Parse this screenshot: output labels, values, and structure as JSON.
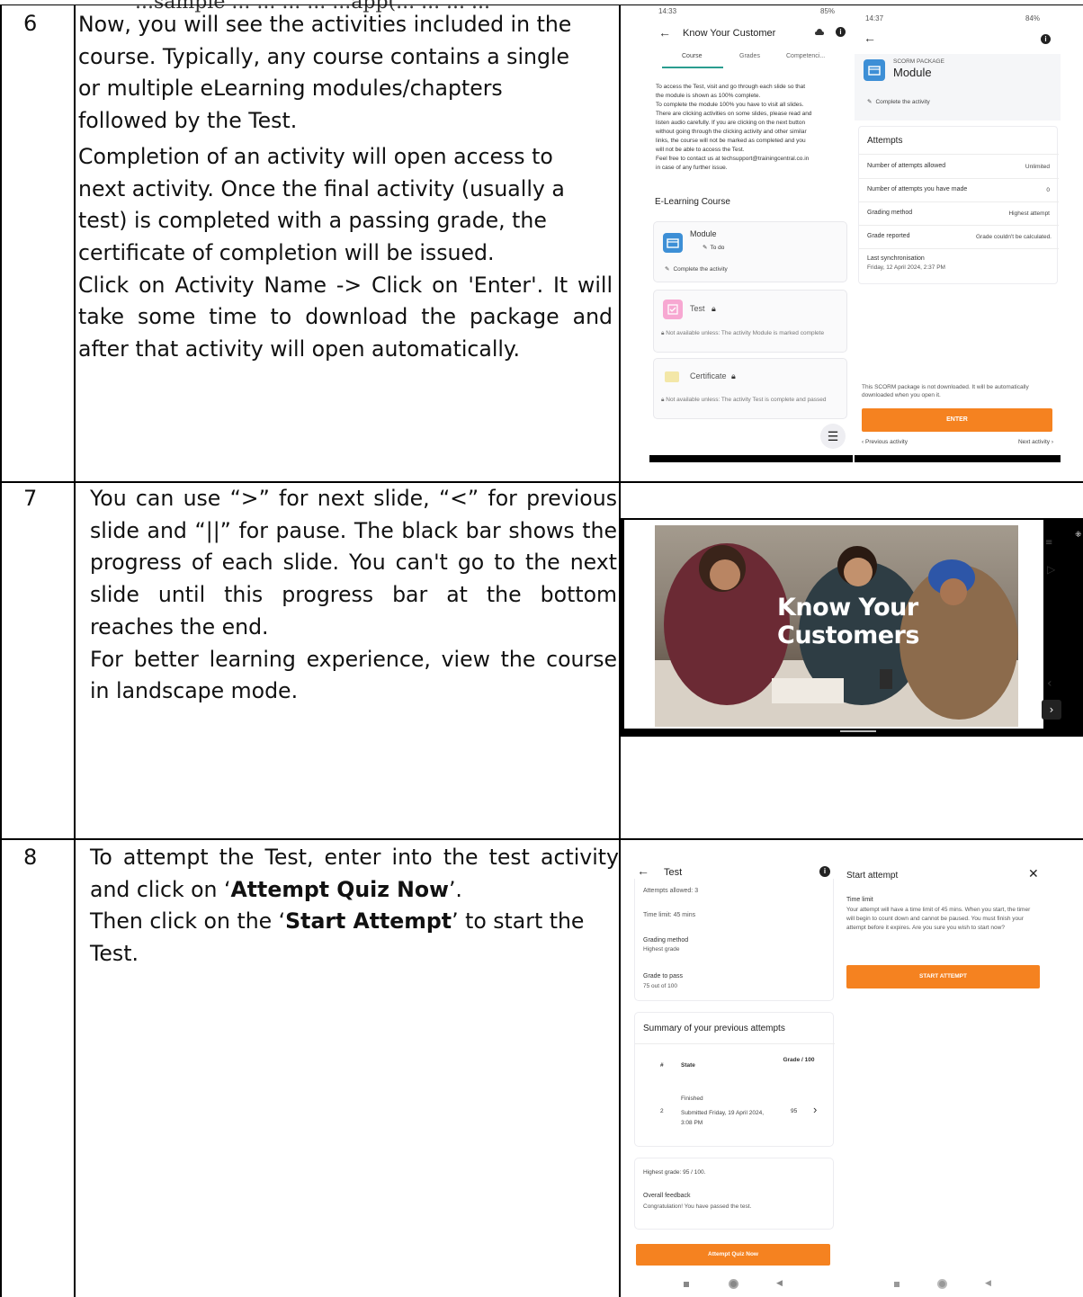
{
  "top_fragment": "...sample ... ... ... ... ...app(... ... ... ...",
  "rows": [
    {
      "number": "6",
      "paragraphs": [
        "Now, you will see the activities included in the course. Typically, any course contains a single or multiple eLearning modules/chapters followed by the Test.",
        "Completion of an activity will open access to next activity. Once the final activity (usually a test) is completed with a passing grade, the certificate of completion will be issued.",
        "Click on Activity Name -> Click on 'Enter'. It will take some time to download the package and after that activity will open automatically."
      ]
    },
    {
      "number": "7",
      "paragraphs": [
        "You can use “>” for next slide, “<” for previous slide and “||” for pause. The black bar shows the progress of each slide. You can't go to the next slide until this progress bar at the bottom reaches the end.",
        "For better learning experience, view the course in landscape mode."
      ]
    },
    {
      "number": "8",
      "paragraphs": [
        {
          "pre": "To attempt the Test, enter into the test activity and click on ‘",
          "bold": "Attempt Quiz Now",
          "post": "’."
        },
        {
          "pre": "Then click on the ‘",
          "bold": "Start Attempt",
          "post": "’ to start the Test."
        }
      ]
    }
  ],
  "phone_course": {
    "status_time": "14:33",
    "status_right": "85%",
    "title": "Know Your Customer",
    "tabs": [
      "Course",
      "Grades",
      "Competenci..."
    ],
    "info_lines": [
      "To access the Test, visit and go through each slide so that",
      "the module is shown as 100% complete.",
      "To complete the module 100% you have to visit all slides.",
      "There are clicking activities on some slides, please read and",
      "listen audio carefully. If you are clicking on the next button",
      "without going through the clicking activity and other similar",
      "links, the course will not be marked as completed and you",
      "will not be able to access the Test.",
      "Feel free to contact us at techsupport@trainingcentral.co.in",
      "in case of any further issue."
    ],
    "section": "E-Learning Course",
    "module_name": "Module",
    "module_status": "To do",
    "module_action": "Complete the activity",
    "test_name": "Test",
    "test_note": "Not available unless: The activity Module is marked complete",
    "cert_name": "Certificate",
    "cert_note": "Not available unless: The activity Test is complete and passed"
  },
  "phone_scorm": {
    "status_time": "14:37",
    "status_right": "84%",
    "kicker": "SCORM PACKAGE",
    "title": "Module",
    "action": "Complete the activity",
    "attempts_heading": "Attempts",
    "rows": [
      {
        "label": "Number of attempts allowed",
        "value": "Unlimited"
      },
      {
        "label": "Number of attempts you have made",
        "value": "0"
      },
      {
        "label": "Grading method",
        "value": "Highest attempt"
      },
      {
        "label": "Grade reported",
        "value": "Grade couldn't be calculated."
      }
    ],
    "last_sync_label": "Last synchronisation",
    "last_sync_value": "Friday, 12 April 2024, 2:37 PM",
    "download_note": "This SCORM package is not downloaded. It will be automatically downloaded when you open it.",
    "enter": "ENTER",
    "prev": "Previous activity",
    "next": "Next activity"
  },
  "slide": {
    "title_line1": "Know Your",
    "title_line2": "Customers"
  },
  "phone_quiz": {
    "title": "Test",
    "attempts_allowed": "Attempts allowed: 3",
    "time_limit": "Time limit: 45 mins",
    "grading_label": "Grading method",
    "grading_value": "Highest grade",
    "pass_label": "Grade to pass",
    "pass_value": "75 out of 100",
    "summary_heading": "Summary of your previous attempts",
    "col_num": "#",
    "col_state": "State",
    "col_grade": "Grade / 100",
    "attempt_num": "2",
    "attempt_state": "Finished",
    "attempt_submitted": "Submitted Friday, 19 April 2024, 3:08 PM",
    "attempt_grade": "95",
    "highest_grade": "Highest grade: 95 / 100.",
    "feedback_label": "Overall feedback",
    "feedback_value": "Congratulation! You have passed the test.",
    "button": "Attempt Quiz Now"
  },
  "phone_start": {
    "title": "Start attempt",
    "time_limit_label": "Time limit",
    "body": "Your attempt will have a time limit of 45 mins. When you start, the timer will begin to count down and cannot be paused. You must finish your attempt before it expires. Are you sure you wish to start now?",
    "button": "START ATTEMPT"
  },
  "colors": {
    "accent": "#f58220",
    "link": "#1a5fb4",
    "module_icon": "#3d8fd6",
    "test_icon": "#e67ab8"
  }
}
